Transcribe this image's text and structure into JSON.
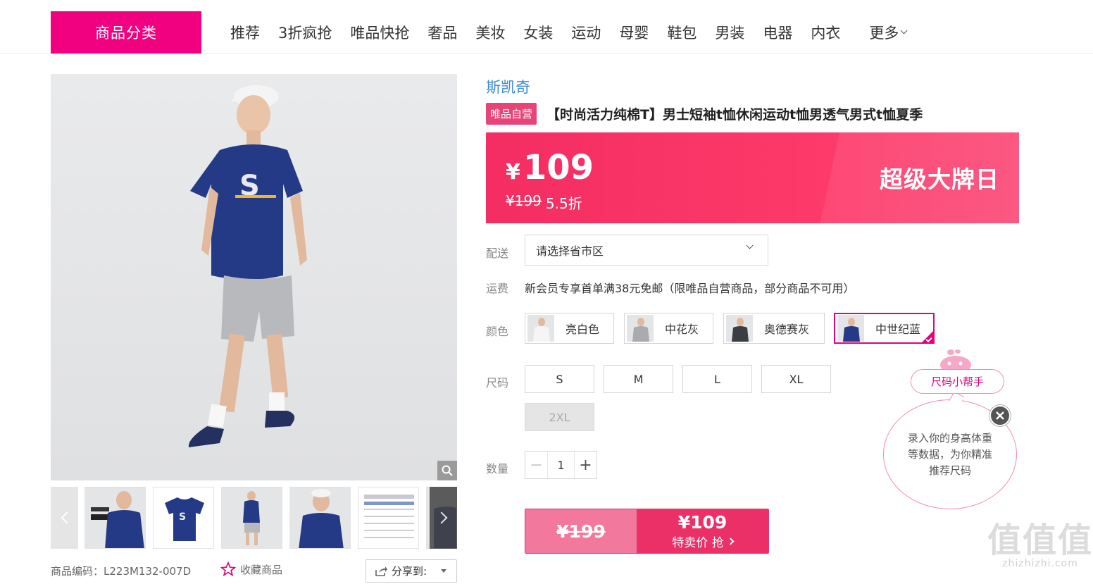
{
  "nav": {
    "category_button": "商品分类",
    "items": [
      "推荐",
      "3折疯抢",
      "唯品快抢",
      "奢品",
      "美妆",
      "女装",
      "运动",
      "母婴",
      "鞋包",
      "男装",
      "电器",
      "内衣"
    ],
    "more": "更多"
  },
  "product": {
    "brand": "斯凯奇",
    "tag": "唯品自营",
    "title": "【时尚活力纯棉T】男士短袖t恤休闲运动t恤男透气男式t恤夏季",
    "code_label": "商品编码：L223M132-007D",
    "favorite": "收藏商品",
    "share": "分享到:"
  },
  "price": {
    "currency": "¥",
    "current": "109",
    "original": "¥199",
    "discount": "5.5折",
    "promo": "超级大牌日"
  },
  "delivery": {
    "label": "配送",
    "region_placeholder": "请选择省市区",
    "freight_label": "运费",
    "freight_text": "新会员专享首单满38元免邮（限唯品自营商品，部分商品不可用）"
  },
  "colors": {
    "label": "颜色",
    "options": [
      "亮白色",
      "中花灰",
      "奥德赛灰",
      "中世纪蓝"
    ],
    "selected": "中世纪蓝"
  },
  "sizes": {
    "label": "尺码",
    "options": [
      "S",
      "M",
      "L",
      "XL",
      "2XL"
    ],
    "disabled": [
      "2XL"
    ]
  },
  "quantity": {
    "label": "数量",
    "value": "1",
    "minus": "−",
    "plus": "+"
  },
  "buy": {
    "original": "¥199",
    "price": "¥109",
    "action": "特卖价 抢"
  },
  "size_helper": {
    "title": "尺码小帮手",
    "message": "录入你的身高体重等数据，为你精准推荐尺码"
  },
  "watermark": {
    "big": "值值值",
    "small": "zhizhizhi.com"
  },
  "colors_theme": {
    "brand_pink": "#f10180",
    "price_red": "#f42d62",
    "link_blue": "#3b8ad6"
  }
}
